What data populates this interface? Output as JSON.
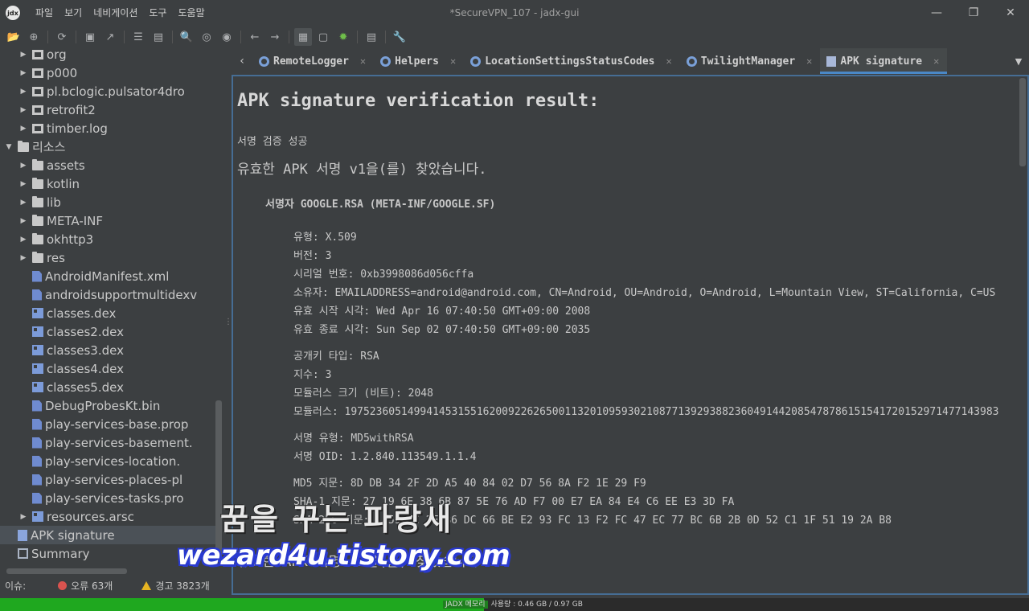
{
  "app": {
    "title": "*SecureVPN_107 - jadx-gui",
    "logo_text": "jdx",
    "menu": [
      "파일",
      "보기",
      "네비게이션",
      "도구",
      "도움말"
    ]
  },
  "window_controls": {
    "minimize": "—",
    "maximize": "❐",
    "close": "✕"
  },
  "toolbar": {
    "icons": [
      "open-icon",
      "add-files-icon",
      "sync-icon",
      "save-icon",
      "export-icon",
      "flatten-icon",
      "tree-icon",
      "search-icon",
      "find-class-icon",
      "find-usage-icon",
      "back-icon",
      "forward-icon",
      "deobfuscate-icon",
      "quark-icon",
      "debug-icon",
      "log-icon",
      "settings-icon"
    ]
  },
  "tree": {
    "items": [
      {
        "label": "org",
        "type": "pkg",
        "arrow": "▶",
        "indent": 1
      },
      {
        "label": "p000",
        "type": "pkg",
        "arrow": "▶",
        "indent": 1
      },
      {
        "label": "pl.bclogic.pulsator4dro",
        "type": "pkg",
        "arrow": "▶",
        "indent": 1
      },
      {
        "label": "retrofit2",
        "type": "pkg",
        "arrow": "▶",
        "indent": 1
      },
      {
        "label": "timber.log",
        "type": "pkg",
        "arrow": "▶",
        "indent": 1
      },
      {
        "label": "리소스",
        "type": "folder",
        "arrow": "▼",
        "indent": 0
      },
      {
        "label": "assets",
        "type": "folder",
        "arrow": "▶",
        "indent": 1
      },
      {
        "label": "kotlin",
        "type": "folder",
        "arrow": "▶",
        "indent": 1
      },
      {
        "label": "lib",
        "type": "folder",
        "arrow": "▶",
        "indent": 1
      },
      {
        "label": "META-INF",
        "type": "folder",
        "arrow": "▶",
        "indent": 1
      },
      {
        "label": "okhttp3",
        "type": "folder",
        "arrow": "▶",
        "indent": 1
      },
      {
        "label": "res",
        "type": "folder",
        "arrow": "▶",
        "indent": 1
      },
      {
        "label": "AndroidManifest.xml",
        "type": "file",
        "arrow": "",
        "indent": 1
      },
      {
        "label": "androidsupportmultidexv",
        "type": "file",
        "arrow": "",
        "indent": 1
      },
      {
        "label": "classes.dex",
        "type": "dex",
        "arrow": "",
        "indent": 1
      },
      {
        "label": "classes2.dex",
        "type": "dex",
        "arrow": "",
        "indent": 1
      },
      {
        "label": "classes3.dex",
        "type": "dex",
        "arrow": "",
        "indent": 1
      },
      {
        "label": "classes4.dex",
        "type": "dex",
        "arrow": "",
        "indent": 1
      },
      {
        "label": "classes5.dex",
        "type": "dex",
        "arrow": "",
        "indent": 1
      },
      {
        "label": "DebugProbesKt.bin",
        "type": "file",
        "arrow": "",
        "indent": 1
      },
      {
        "label": "play-services-base.prop",
        "type": "file",
        "arrow": "",
        "indent": 1
      },
      {
        "label": "play-services-basement.",
        "type": "file",
        "arrow": "",
        "indent": 1
      },
      {
        "label": "play-services-location.",
        "type": "file",
        "arrow": "",
        "indent": 1
      },
      {
        "label": "play-services-places-pl",
        "type": "file",
        "arrow": "",
        "indent": 1
      },
      {
        "label": "play-services-tasks.pro",
        "type": "file",
        "arrow": "",
        "indent": 1
      },
      {
        "label": "resources.arsc",
        "type": "dex",
        "arrow": "▶",
        "indent": 1
      },
      {
        "label": "APK signature",
        "type": "sig",
        "arrow": "",
        "indent": 0,
        "selected": true
      },
      {
        "label": "Summary",
        "type": "summary",
        "arrow": "",
        "indent": 0
      }
    ]
  },
  "tabs": [
    {
      "label": "RemoteLogger",
      "icon": "class"
    },
    {
      "label": "Helpers",
      "icon": "class"
    },
    {
      "label": "LocationSettingsStatusCodes",
      "icon": "class"
    },
    {
      "label": "TwilightManager",
      "icon": "class"
    },
    {
      "label": "APK signature",
      "icon": "sig",
      "active": true
    }
  ],
  "content": {
    "heading": "APK signature verification result:",
    "status": "서명 검증 성공",
    "found_v1": "유효한 APK 서명 v1을(를) 찾았습니다.",
    "signer": "서명자 GOOGLE.RSA (META-INF/GOOGLE.SF)",
    "cert": [
      "유형: X.509",
      "버전: 3",
      "시리얼 번호: 0xb3998086d056cffa",
      "소유자: EMAILADDRESS=android@android.com, CN=Android, OU=Android, O=Android, L=Mountain View, ST=California, C=US",
      "유효 시작 시각: Wed Apr 16 07:40:50 GMT+09:00 2008",
      "유효 종료 시각: Sun Sep 02 07:40:50 GMT+09:00 2035"
    ],
    "key": [
      "공개키 타입: RSA",
      "지수: 3",
      "모듈러스 크기 (비트): 2048",
      "모듈러스: 19752360514994145315516200922626500113201095930210877139293882360491442085478786151541720152971477143983"
    ],
    "sig": [
      "서명 유형: MD5withRSA",
      "서명 OID: 1.2.840.113549.1.1.4"
    ],
    "digests": [
      "MD5 지문: 8D DB 34 2F 2D A5 40 84 02 D7 56 8A F2 1E 29 F9",
      "SHA-1 지문: 27 19 6E 38 6B 87 5E 76 AD F7 00 E7 EA 84 E4 C6 EE E3 3D FA",
      "SHA-256 지문: … 59 7C 2F B6 DC 66 BE E2 93 FC 13 F2 FC 47 EC 77 BC 6B 2B 0D 52 C1 1F 51 19 2A B8"
    ],
    "found_v2": "유효한 APK 서명 v2을(를) 찾았습니다."
  },
  "status": {
    "issues_label": "이슈:",
    "errors": "오류 63개",
    "warnings": "경고 3823개"
  },
  "memory": {
    "label": "JADX 메모리",
    "usage": "사용량 : 0.46 GB / 0.97 GB",
    "fraction": 0.47
  },
  "watermark": {
    "line1": "꿈을 꾸는 파랑새",
    "line2": "wezard4u.tistory.com"
  },
  "colors": {
    "background": "#3c3f41",
    "accent": "#4a88c7",
    "memory_bar": "#1fa81f",
    "error": "#d9534f",
    "warning": "#e6b422"
  }
}
